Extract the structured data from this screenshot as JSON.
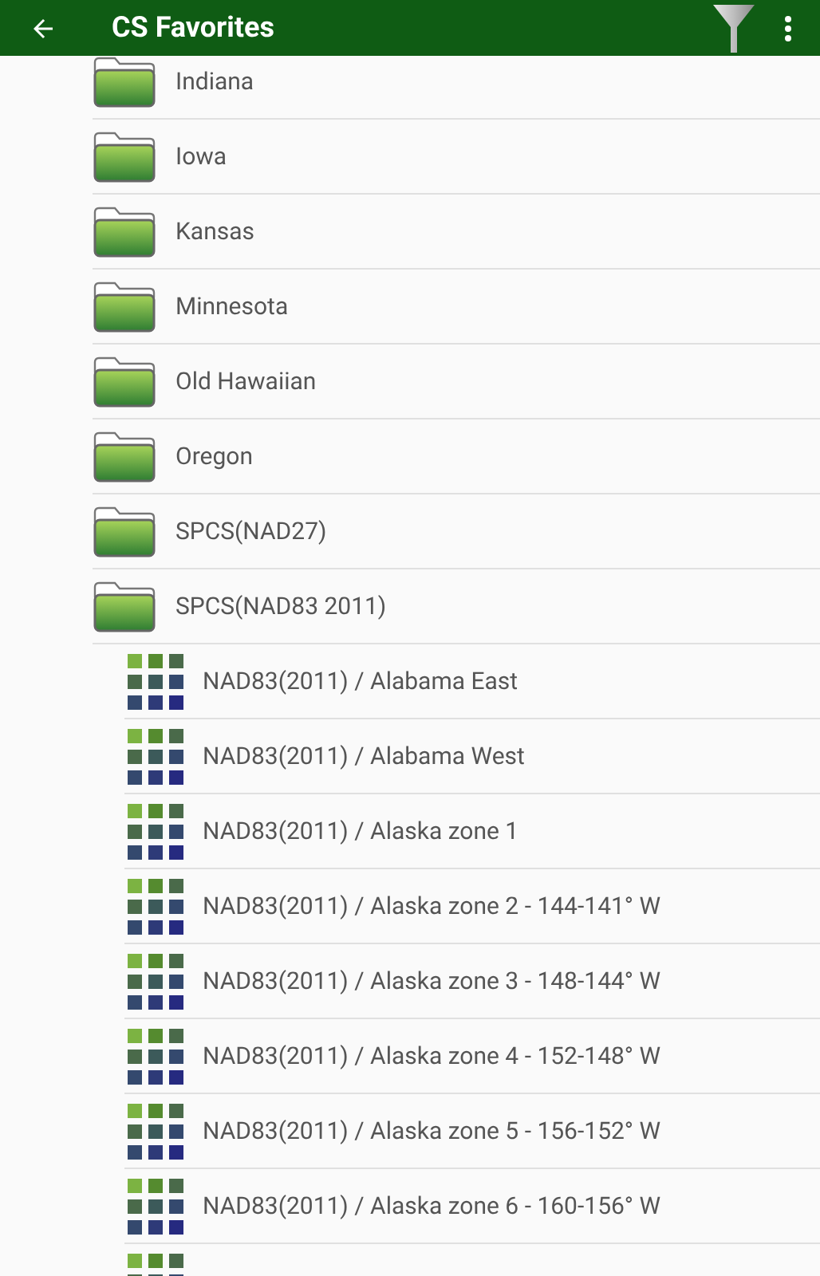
{
  "app_bar": {
    "title": "CS Favorites"
  },
  "folders": [
    {
      "label": "Indiana"
    },
    {
      "label": "Iowa"
    },
    {
      "label": "Kansas"
    },
    {
      "label": "Minnesota"
    },
    {
      "label": "Old Hawaiian"
    },
    {
      "label": "Oregon"
    },
    {
      "label": "SPCS(NAD27)"
    },
    {
      "label": "SPCS(NAD83 2011)",
      "children": [
        {
          "kind": "coordinate_system",
          "label": "NAD83(2011) / Alabama East"
        },
        {
          "kind": "coordinate_system",
          "label": "NAD83(2011) / Alabama West"
        },
        {
          "kind": "coordinate_system",
          "label": "NAD83(2011) / Alaska zone 1"
        },
        {
          "kind": "coordinate_system",
          "label": "NAD83(2011) / Alaska zone 2 - 144-141° W"
        },
        {
          "kind": "coordinate_system",
          "label": "NAD83(2011) / Alaska zone 3 - 148-144° W"
        },
        {
          "kind": "coordinate_system",
          "label": "NAD83(2011) / Alaska zone 4 - 152-148° W"
        },
        {
          "kind": "coordinate_system",
          "label": "NAD83(2011) / Alaska zone 5 - 156-152° W"
        },
        {
          "kind": "coordinate_system",
          "label": "NAD83(2011) / Alaska zone 6 - 160-156° W"
        },
        {
          "kind": "cut_off"
        }
      ]
    }
  ]
}
